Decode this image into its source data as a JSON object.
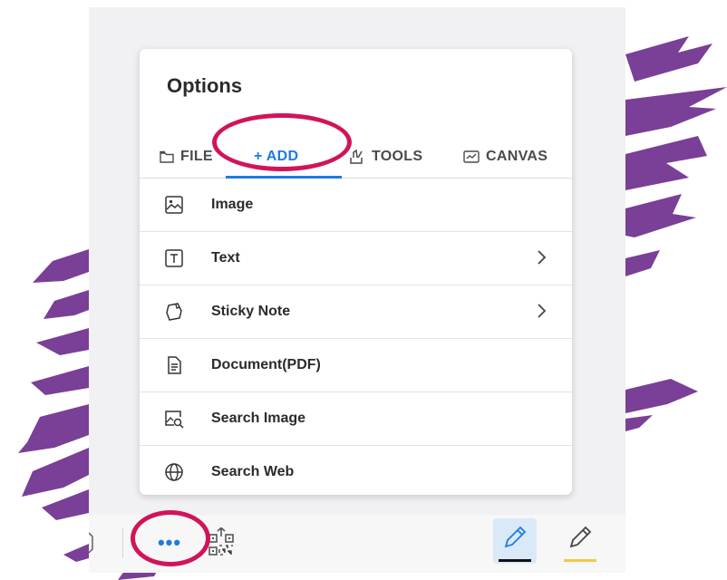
{
  "panel": {
    "title": "Options"
  },
  "tabs": [
    {
      "label": "FILE",
      "icon": "folder-icon",
      "active": false
    },
    {
      "label": "+ ADD",
      "icon": "plus-icon",
      "active": true
    },
    {
      "label": "TOOLS",
      "icon": "tools-icon",
      "active": false
    },
    {
      "label": "CANVAS",
      "icon": "canvas-icon",
      "active": false
    }
  ],
  "menu": [
    {
      "label": "Image",
      "icon": "image-icon",
      "has_submenu": false
    },
    {
      "label": "Text",
      "icon": "text-icon",
      "has_submenu": true
    },
    {
      "label": "Sticky Note",
      "icon": "sticky-note-icon",
      "has_submenu": true
    },
    {
      "label": "Document(PDF)",
      "icon": "document-icon",
      "has_submenu": false
    },
    {
      "label": "Search Image",
      "icon": "search-image-icon",
      "has_submenu": false
    },
    {
      "label": "Search Web",
      "icon": "globe-icon",
      "has_submenu": false
    }
  ],
  "toolbar": {
    "more_label": "•••",
    "pen1_color": "#111111",
    "pen2_color": "#f2c94c"
  },
  "colors": {
    "accent": "#1f7be0",
    "highlight_circle": "#d1145a",
    "splash": "#7a3f96"
  }
}
